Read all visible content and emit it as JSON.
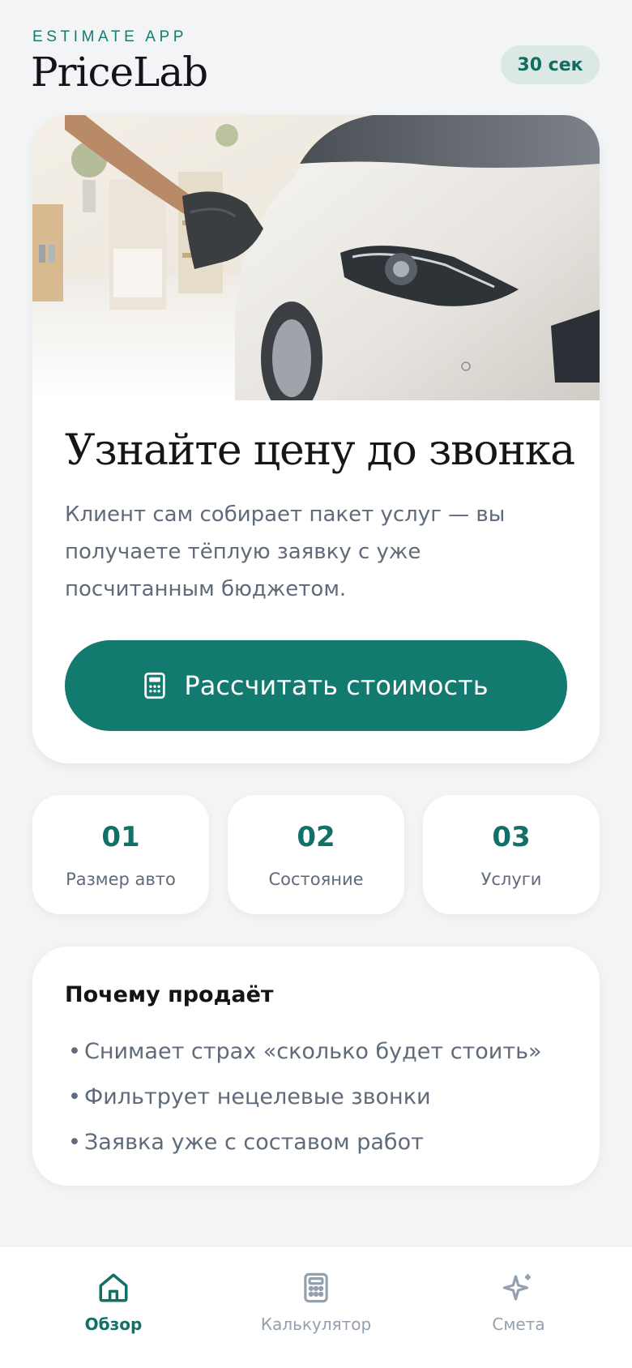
{
  "header": {
    "eyebrow": "ESTIMATE APP",
    "title": "PriceLab",
    "badge": "30 сек"
  },
  "hero": {
    "image_desc": "car-detailing-photo",
    "title": "Узнайте цену до звонка",
    "description": "Клиент сам собирает пакет услуг — вы получаете тёплую заявку с уже посчитанным бюджетом.",
    "cta_label": "Рассчитать стоимость",
    "cta_icon": "calculator-icon"
  },
  "steps": [
    {
      "num": "01",
      "label": "Размер авто"
    },
    {
      "num": "02",
      "label": "Состояние"
    },
    {
      "num": "03",
      "label": "Услуги"
    }
  ],
  "why": {
    "title": "Почему продаёт",
    "bullet": "•",
    "items": [
      "Снимает страх «сколько будет стоить»",
      "Фильтрует нецелевые звонки",
      "Заявка уже с составом работ"
    ]
  },
  "nav": {
    "items": [
      {
        "label": "Обзор",
        "icon": "home-icon",
        "active": true
      },
      {
        "label": "Калькулятор",
        "icon": "calculator-icon",
        "active": false
      },
      {
        "label": "Смета",
        "icon": "sparkle-icon",
        "active": false
      }
    ]
  },
  "colors": {
    "accent": "#137a6f",
    "background": "#f2f4f6",
    "muted_text": "#5f6b7a",
    "inactive_nav": "#95a0ad"
  }
}
